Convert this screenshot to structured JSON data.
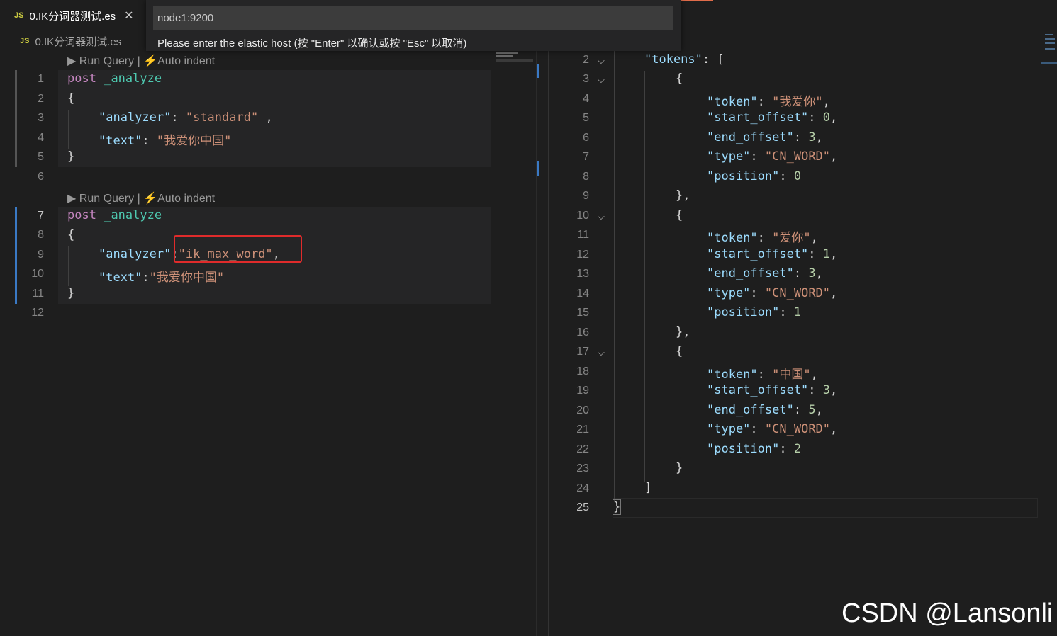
{
  "tab": {
    "badge": "JS",
    "label": "0.IK分词器测试.es",
    "close": "✕"
  },
  "breadcrumb": {
    "badge": "JS",
    "label": "0.IK分词器测试.es"
  },
  "quick_input": {
    "value": "node1:9200",
    "message": "Please enter the elastic host (按 \"Enter\" 以确认或按 \"Esc\" 以取消)"
  },
  "codelens": {
    "run_query": "Run Query",
    "separator": "|",
    "auto_indent": "Auto indent"
  },
  "left_lines": [
    "1",
    "2",
    "3",
    "4",
    "5",
    "6",
    "7",
    "8",
    "9",
    "10",
    "11",
    "12"
  ],
  "query1": {
    "method": "post",
    "endpoint": "_analyze",
    "open": "{",
    "close": "}",
    "analyzer_key": "\"analyzer\"",
    "analyzer_value": "\"standard\"",
    "text_key": "\"text\"",
    "text_value": "\"我爱你中国\""
  },
  "query2": {
    "method": "post",
    "endpoint": "_analyze",
    "open": "{",
    "close": "}",
    "analyzer_key": "\"analyzer\"",
    "analyzer_value": "\"ik_max_word\"",
    "text_key": "\"text\"",
    "text_value": "\"我爱你中国\""
  },
  "response": {
    "line_numbers": [
      "2",
      "3",
      "4",
      "5",
      "6",
      "7",
      "8",
      "9",
      "10",
      "11",
      "12",
      "13",
      "14",
      "15",
      "16",
      "17",
      "18",
      "19",
      "20",
      "21",
      "22",
      "23",
      "24",
      "25"
    ],
    "tokens_key": "\"tokens\"",
    "tokens": [
      {
        "token": "\"我爱你\"",
        "start_offset": "0",
        "end_offset": "3",
        "type": "\"CN_WORD\"",
        "position": "0"
      },
      {
        "token": "\"爱你\"",
        "start_offset": "1",
        "end_offset": "3",
        "type": "\"CN_WORD\"",
        "position": "1"
      },
      {
        "token": "\"中国\"",
        "start_offset": "3",
        "end_offset": "5",
        "type": "\"CN_WORD\"",
        "position": "2"
      }
    ],
    "keys": {
      "token": "\"token\"",
      "start_offset": "\"start_offset\"",
      "end_offset": "\"end_offset\"",
      "type": "\"type\"",
      "position": "\"position\""
    }
  },
  "watermark": "CSDN @Lansonli",
  "colors": {
    "accent": "#3a79c4",
    "highlight_box": "#e02b2b"
  }
}
